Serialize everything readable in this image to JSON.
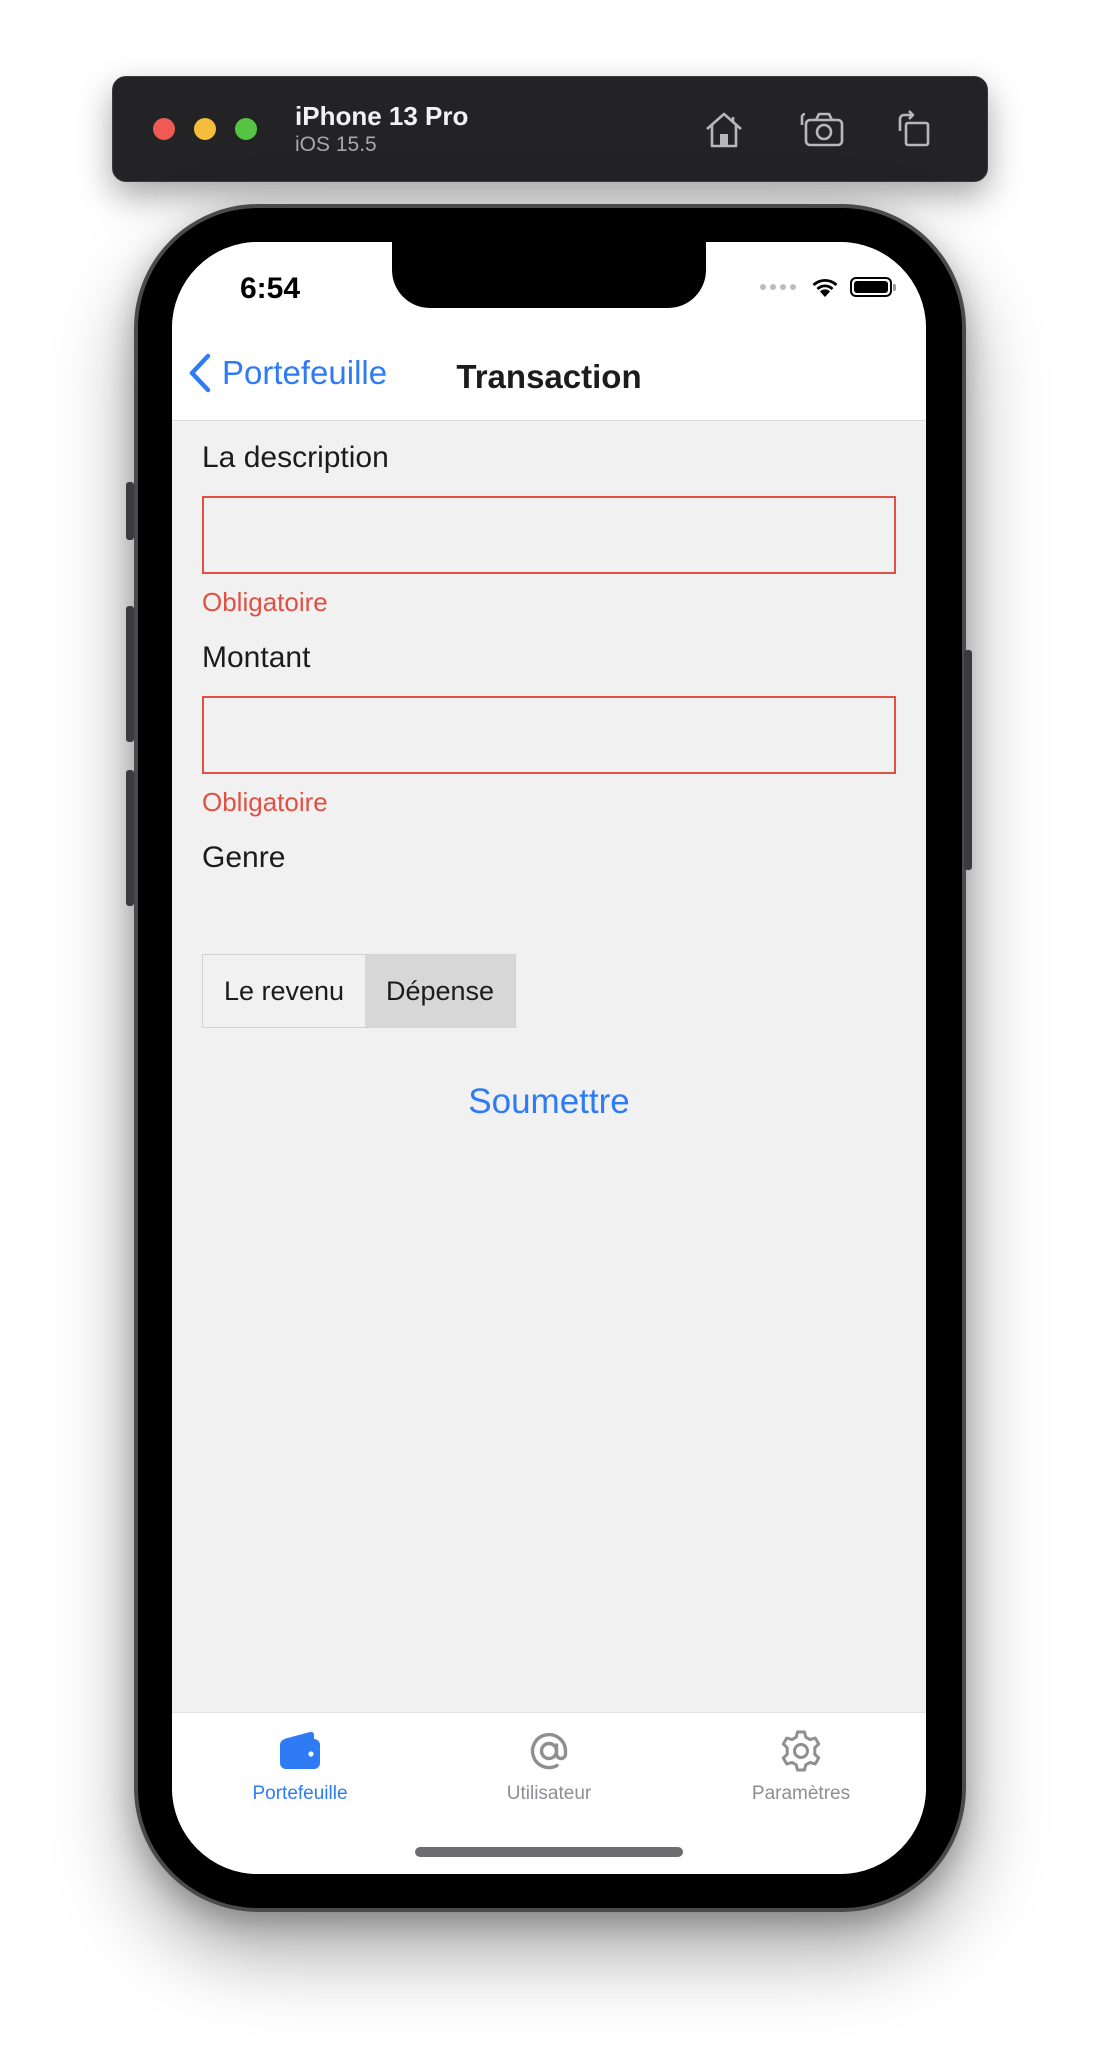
{
  "simulator": {
    "device_name": "iPhone 13 Pro",
    "os_version": "iOS 15.5",
    "buttons": [
      "home-icon",
      "screenshot-icon",
      "rotate-icon"
    ]
  },
  "status_bar": {
    "time": "6:54"
  },
  "nav": {
    "back_label": "Portefeuille",
    "title": "Transaction"
  },
  "form": {
    "description_label": "La description",
    "description_value": "",
    "description_error": "Obligatoire",
    "amount_label": "Montant",
    "amount_value": "",
    "amount_error": "Obligatoire",
    "type_label": "Genre",
    "type_options": [
      "Le revenu",
      "Dépense"
    ],
    "type_selected": "Dépense",
    "submit_label": "Soumettre"
  },
  "tabs": [
    {
      "label": "Portefeuille",
      "icon": "wallet-icon",
      "active": true
    },
    {
      "label": "Utilisateur",
      "icon": "at-icon",
      "active": false
    },
    {
      "label": "Paramètres",
      "icon": "gear-icon",
      "active": false
    }
  ],
  "colors": {
    "accent": "#2f7bf6",
    "error": "#e05144",
    "background": "#f1f1f1",
    "inactive": "#8e8e93"
  }
}
